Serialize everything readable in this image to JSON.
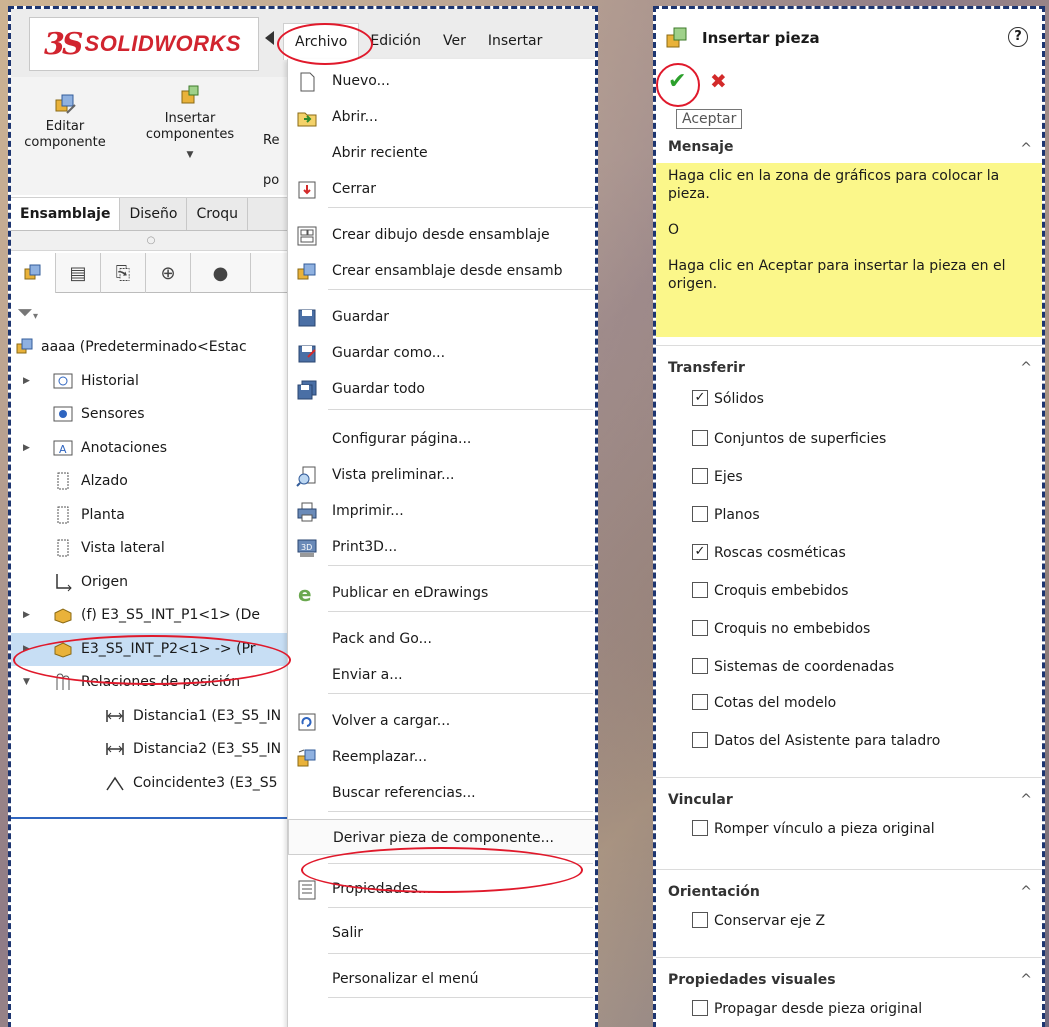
{
  "app": {
    "logo_mark": "3S",
    "logo_text": "SOLIDWORKS",
    "menus": [
      "Archivo",
      "Edición",
      "Ver",
      "Insertar"
    ]
  },
  "ribbon": {
    "edit_component": "Editar\ncomponente",
    "insert_components": "Insertar\ncomponentes",
    "partial_1": "Re",
    "partial_2": "po"
  },
  "command_tabs": [
    "Ensamblaje",
    "Diseño",
    "Croqu"
  ],
  "feature_tree": {
    "items": [
      {
        "label": "aaaa  (Predeterminado<Estac",
        "icon": "assembly-icon",
        "indent": 0,
        "expander": ""
      },
      {
        "label": "Historial",
        "icon": "history-icon",
        "indent": 1,
        "expander": "▶"
      },
      {
        "label": "Sensores",
        "icon": "sensor-icon",
        "indent": 1,
        "expander": ""
      },
      {
        "label": "Anotaciones",
        "icon": "annotation-icon",
        "indent": 1,
        "expander": "▶"
      },
      {
        "label": "Alzado",
        "icon": "plane-icon",
        "indent": 1,
        "expander": ""
      },
      {
        "label": "Planta",
        "icon": "plane-icon",
        "indent": 1,
        "expander": ""
      },
      {
        "label": "Vista lateral",
        "icon": "plane-icon",
        "indent": 1,
        "expander": ""
      },
      {
        "label": "Origen",
        "icon": "origin-icon",
        "indent": 1,
        "expander": ""
      },
      {
        "label": "(f) E3_S5_INT_P1<1> (De",
        "icon": "part-icon",
        "indent": 1,
        "expander": "▶"
      },
      {
        "label": "E3_S5_INT_P2<1> -> (Pr",
        "icon": "part-icon",
        "indent": 1,
        "expander": "▶",
        "selected": true
      },
      {
        "label": "Relaciones de posición",
        "icon": "mate-icon",
        "indent": 1,
        "expander": "▼"
      },
      {
        "label": "Distancia1 (E3_S5_IN",
        "icon": "distance-mate-icon",
        "indent": 2,
        "expander": ""
      },
      {
        "label": "Distancia2 (E3_S5_IN",
        "icon": "distance-mate-icon",
        "indent": 2,
        "expander": ""
      },
      {
        "label": "Coincidente3 (E3_S5",
        "icon": "coincident-mate-icon",
        "indent": 2,
        "expander": ""
      }
    ]
  },
  "file_menu": {
    "items": [
      {
        "label": "Nuevo...",
        "icon": "new-doc-icon"
      },
      {
        "label": "Abrir...",
        "icon": "open-icon"
      },
      {
        "label": "Abrir reciente",
        "icon": ""
      },
      {
        "label": "Cerrar",
        "icon": "close-doc-icon"
      },
      {
        "label": "Crear dibujo desde ensamblaje",
        "icon": "drawing-icon"
      },
      {
        "label": "Crear ensamblaje desde ensamb",
        "icon": "assembly-icon"
      },
      {
        "label": "Guardar",
        "icon": "save-icon"
      },
      {
        "label": "Guardar como...",
        "icon": "save-as-icon"
      },
      {
        "label": "Guardar todo",
        "icon": "save-all-icon"
      },
      {
        "label": "Configurar página...",
        "icon": ""
      },
      {
        "label": "Vista preliminar...",
        "icon": "preview-icon"
      },
      {
        "label": "Imprimir...",
        "icon": "print-icon"
      },
      {
        "label": "Print3D...",
        "icon": "print3d-icon"
      },
      {
        "label": "Publicar en eDrawings",
        "icon": "edrawings-icon"
      },
      {
        "label": "Pack and Go...",
        "icon": ""
      },
      {
        "label": "Enviar a...",
        "icon": ""
      },
      {
        "label": "Volver a cargar...",
        "icon": "reload-icon"
      },
      {
        "label": "Reemplazar...",
        "icon": "replace-icon"
      },
      {
        "label": "Buscar referencias...",
        "icon": ""
      },
      {
        "label": "Derivar pieza de componente...",
        "icon": ""
      },
      {
        "label": "Propiedades...",
        "icon": "properties-icon"
      },
      {
        "label": "Salir",
        "icon": ""
      },
      {
        "label": "Personalizar el menú",
        "icon": ""
      }
    ]
  },
  "property_manager": {
    "title": "Insertar pieza",
    "help": "?",
    "ok_tooltip": "Aceptar",
    "sections": {
      "message": {
        "header": "Mensaje",
        "lines": [
          "Haga clic en la zona de gráficos para colocar la pieza.",
          "O",
          "Haga clic en Aceptar para insertar la pieza en el origen."
        ]
      },
      "transfer": {
        "header": "Transferir",
        "options": [
          {
            "label": "Sólidos",
            "checked": true
          },
          {
            "label": "Conjuntos de superficies",
            "checked": false
          },
          {
            "label": "Ejes",
            "checked": false
          },
          {
            "label": "Planos",
            "checked": false
          },
          {
            "label": "Roscas cosméticas",
            "checked": true
          },
          {
            "label": "Croquis embebidos",
            "checked": false
          },
          {
            "label": "Croquis no embebidos",
            "checked": false
          },
          {
            "label": "Sistemas de coordenadas",
            "checked": false
          },
          {
            "label": "Cotas del modelo",
            "checked": false
          },
          {
            "label": "Datos del Asistente para taladro",
            "checked": false
          }
        ]
      },
      "link": {
        "header": "Vincular",
        "options": [
          {
            "label": "Romper vínculo a pieza original",
            "checked": false
          }
        ]
      },
      "orientation": {
        "header": "Orientación",
        "options": [
          {
            "label": "Conservar eje Z",
            "checked": false
          }
        ]
      },
      "visual": {
        "header": "Propiedades visuales",
        "options": [
          {
            "label": "Propagar desde pieza original",
            "checked": false
          }
        ]
      }
    }
  },
  "colors": {
    "highlight_circle": "#e0192b",
    "dashed_border": "#1d3570",
    "message_bg": "#fbf78a",
    "selected_row": "#c7def4",
    "brand_red": "#d1242f"
  }
}
